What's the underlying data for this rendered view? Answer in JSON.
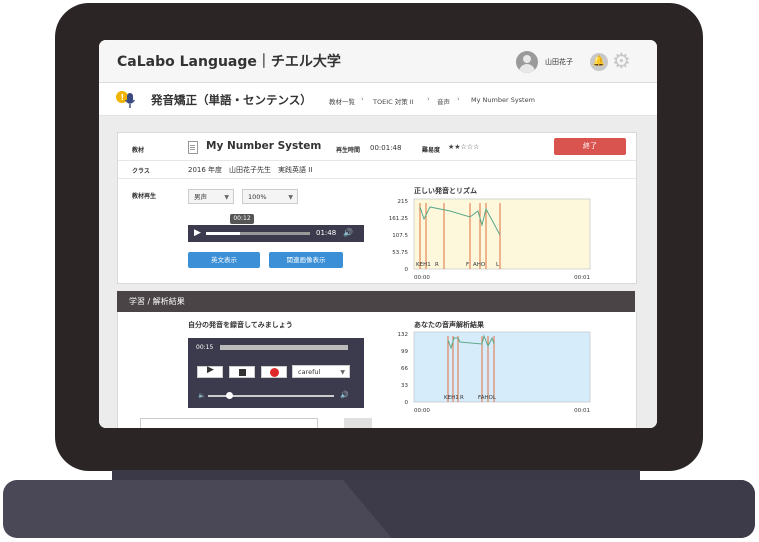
{
  "app": {
    "title": "CaLabo Language｜チエル大学",
    "user_name": "山田花子"
  },
  "page": {
    "title": "発音矯正（単語・センテンス）",
    "breadcrumb": [
      "教材一覧",
      "TOEIC 対策 II",
      "音声",
      "My Number System"
    ]
  },
  "material": {
    "label_material": "教材",
    "name": "My Number System",
    "label_duration": "再生時間",
    "duration": "00:01:48",
    "label_difficulty": "難易度",
    "difficulty": "★★☆☆☆",
    "end_button": "終了",
    "label_class": "クラス",
    "class_info": "2016 年度　山田花子先生　実践英語 II",
    "label_playback": "教材再生",
    "voice_select": "男声",
    "speed_select": "100%",
    "current_time": "00:12",
    "total_time": "01:48",
    "progress": 0.33,
    "show_english_button": "英文表示",
    "related_video_button": "関連画像表示"
  },
  "correct_chart": {
    "title": "正しい発音とリズム",
    "y_ticks": [
      "215",
      "161.25",
      "107.5",
      "53.75",
      "0"
    ],
    "x_start": "00:00",
    "x_end": "00:01",
    "markers": [
      "KEH1",
      "R",
      "F",
      "AHO",
      "L"
    ]
  },
  "section2": {
    "title": "学習 / 解析結果",
    "record_heading": "自分の発音を録音してみましょう",
    "record_time": "00:15",
    "mode_select": "careful",
    "analysis_title": "あなたの音声解析結果",
    "y_ticks": [
      "132",
      "99",
      "66",
      "33",
      "0"
    ],
    "x_start": "00:00",
    "x_end": "00:01",
    "markers": [
      "KEH1",
      "R",
      "FAHOL"
    ]
  },
  "colors": {
    "accent_blue": "#3b8fd6",
    "end_red": "#d9534f",
    "chart_line": "#5aa88a",
    "marker": "#e07040"
  }
}
